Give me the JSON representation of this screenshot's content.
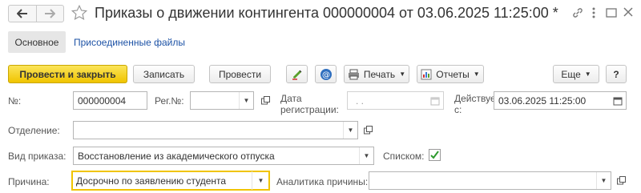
{
  "window": {
    "title": "Приказы о движении контингента 000000004 от 03.06.2025 11:25:00 *"
  },
  "tabs": {
    "main": "Основное",
    "attached_files": "Присоединенные файлы"
  },
  "toolbar": {
    "post_and_close": "Провести и закрыть",
    "save": "Записать",
    "post": "Провести",
    "print": "Печать",
    "reports": "Отчеты",
    "more": "Еще",
    "help": "?"
  },
  "form": {
    "number": {
      "label": "№:",
      "value": "000000004"
    },
    "reg_number": {
      "label": "Рег.№:",
      "value": ""
    },
    "reg_date": {
      "label_line1": "Дата",
      "label_line2": "регистрации:",
      "value": ". ."
    },
    "valid_from": {
      "label_line1": "Действует",
      "label_line2": "с:",
      "value": "03.06.2025 11:25:00"
    },
    "department": {
      "label": "Отделение:",
      "value": ""
    },
    "order_type": {
      "label": "Вид приказа:",
      "value": "Восстановление из академического отпуска"
    },
    "as_list": {
      "label": "Списком:",
      "checked": true
    },
    "reason": {
      "label": "Причина:",
      "value": "Досрочно по заявлению студента"
    },
    "reason_analytics": {
      "label": "Аналитика причины:",
      "value": ""
    }
  },
  "colors": {
    "primary_button": "#f0c400",
    "link": "#1e53a6",
    "checkbox_mark": "#2e9a2e"
  }
}
